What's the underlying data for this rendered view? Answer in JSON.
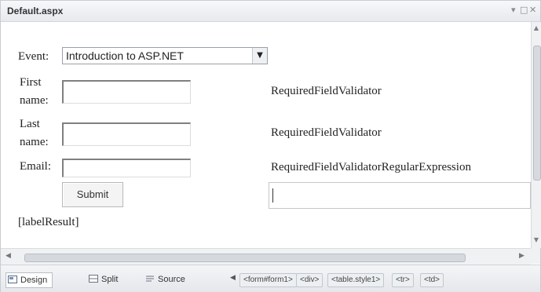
{
  "window": {
    "title": "Default.aspx",
    "controls": {
      "pin": "▾",
      "maximize": "□",
      "close": "✕"
    }
  },
  "form": {
    "event_label": "Event:",
    "event_selected": "Introduction to ASP.NET",
    "first_label_line1": "First",
    "first_label_line2": "name:",
    "last_label_line1": "Last",
    "last_label_line2": "name:",
    "email_label": "Email:",
    "validator_first": "RequiredFieldValidator",
    "validator_last": "RequiredFieldValidator",
    "validator_email": "RequiredFieldValidatorRegularExpression",
    "submit_label": "Submit",
    "result_label": "[labelResult]"
  },
  "view_tabs": [
    {
      "label": "Design",
      "active": true
    },
    {
      "label": "Split",
      "active": false
    },
    {
      "label": "Source",
      "active": false
    }
  ],
  "breadcrumbs": [
    "<form#form1>",
    "<div>",
    "<table.style1>",
    "<tr>",
    "<td>"
  ],
  "icons": [
    "dropdown-arrow-icon",
    "design-view-icon",
    "split-view-icon",
    "source-view-icon"
  ]
}
